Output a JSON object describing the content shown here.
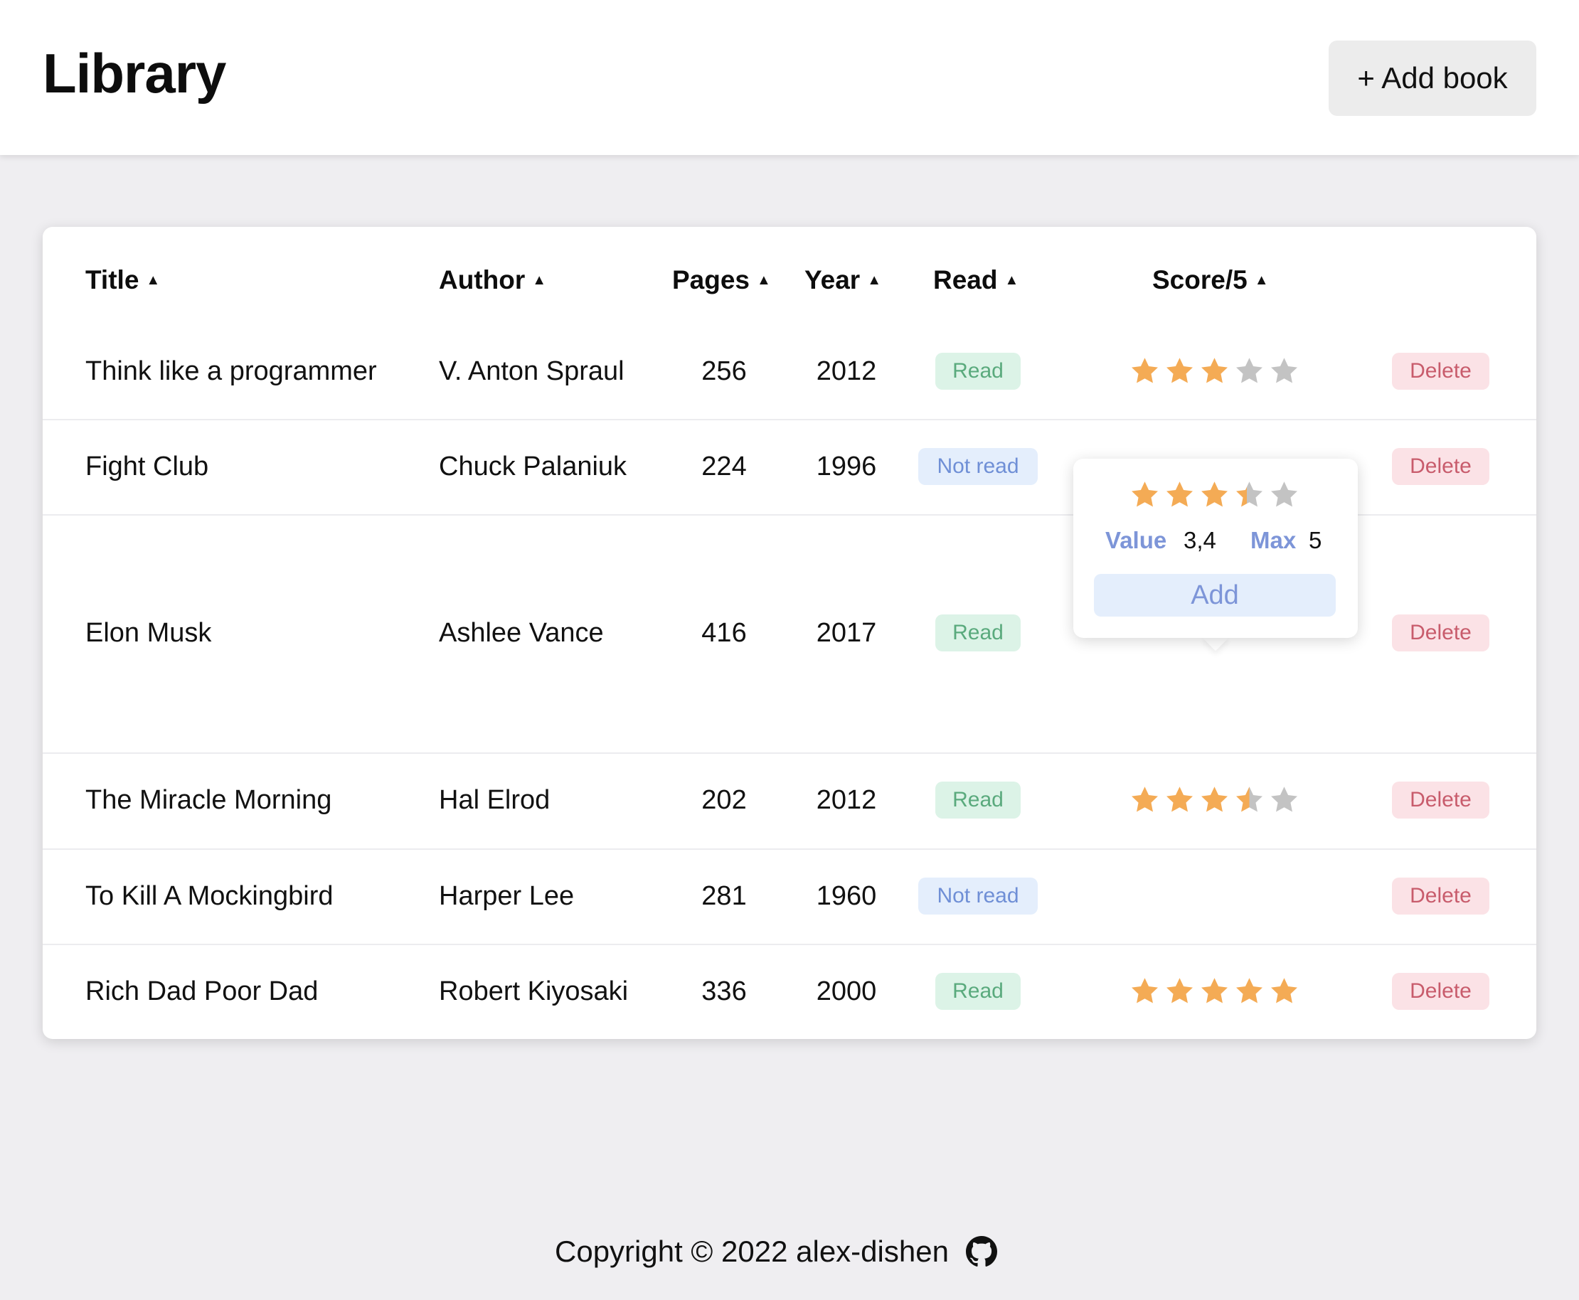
{
  "header": {
    "title": "Library",
    "add_button_label": "+ Add book"
  },
  "table": {
    "columns": [
      {
        "label": "Title",
        "sort_icon": "sort-up-icon"
      },
      {
        "label": "Author",
        "sort_icon": "sort-up-icon"
      },
      {
        "label": "Pages",
        "sort_icon": "sort-up-icon"
      },
      {
        "label": "Year",
        "sort_icon": "sort-up-icon"
      },
      {
        "label": "Read",
        "sort_icon": "sort-up-icon"
      },
      {
        "label": "Score/5",
        "sort_icon": "sort-up-icon"
      }
    ],
    "rows": [
      {
        "title": "Think like a programmer",
        "author": "V. Anton Spraul",
        "pages": "256",
        "year": "2012",
        "read": "Read",
        "score": 3,
        "delete": "Delete"
      },
      {
        "title": "Fight Club",
        "author": "Chuck Palaniuk",
        "pages": "224",
        "year": "1996",
        "read": "Not read",
        "score": null,
        "delete": "Delete"
      },
      {
        "title": "Elon Musk",
        "author": "Ashlee Vance",
        "pages": "416",
        "year": "2017",
        "read": "Read",
        "score": null,
        "delete": "Delete"
      },
      {
        "title": "The Miracle Morning",
        "author": "Hal Elrod",
        "pages": "202",
        "year": "2012",
        "read": "Read",
        "score": 3.5,
        "delete": "Delete"
      },
      {
        "title": "To Kill A Mockingbird",
        "author": "Harper Lee",
        "pages": "281",
        "year": "1960",
        "read": "Not read",
        "score": null,
        "delete": "Delete"
      },
      {
        "title": "Rich Dad Poor Dad",
        "author": "Robert Kiyosaki",
        "pages": "336",
        "year": "2000",
        "read": "Read",
        "score": 5,
        "delete": "Delete"
      }
    ]
  },
  "rating_popover": {
    "stars_value": 3.4,
    "value_label": "Value",
    "value": "3,4",
    "max_label": "Max",
    "max": "5",
    "add_label": "Add"
  },
  "footer": {
    "copyright": "Copyright © 2022 alex-dishen",
    "icon": "github-icon"
  },
  "colors": {
    "star_filled": "#f4ab55",
    "star_empty": "#c3c3c3",
    "read_badge_bg": "#dcf3e7",
    "read_badge_text": "#5aaa7d",
    "notread_badge_bg": "#e4eefc",
    "notread_badge_text": "#6f8fd6",
    "delete_bg": "#fbe2e6",
    "delete_text": "#c85c6c"
  }
}
